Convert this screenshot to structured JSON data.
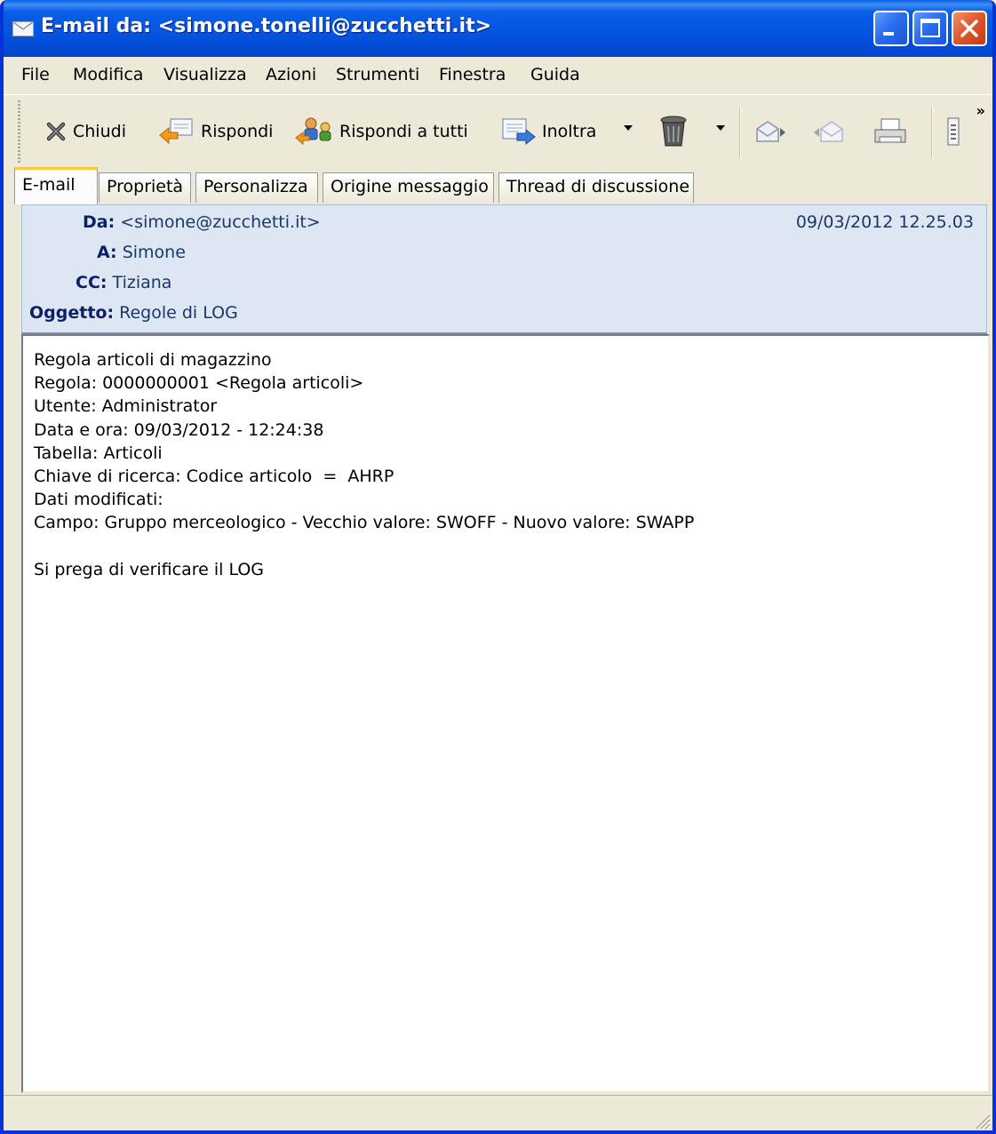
{
  "window": {
    "title": "E-mail da: <simone.tonelli@zucchetti.it>",
    "title_icon": "envelope-icon",
    "controls": [
      "minimize-icon",
      "maximize-icon",
      "close-icon"
    ]
  },
  "menu": [
    "File",
    "Modifica",
    "Visualizza",
    "Azioni",
    "Strumenti",
    "Finestra",
    "Guida"
  ],
  "toolbar": {
    "close_label": "Chiudi",
    "reply_label": "Rispondi",
    "reply_all_label": "Rispondi a tutti",
    "forward_label": "Inoltra",
    "more": "»"
  },
  "tabs": [
    "E-mail",
    "Proprietà",
    "Personalizza",
    "Origine messaggio",
    "Thread di discussione"
  ],
  "header": {
    "from_label": "Da:",
    "from_value": "<simone@zucchetti.it>",
    "to_label": "A:",
    "to_value": "Simone",
    "cc_label": "CC:",
    "cc_value": "Tiziana",
    "subject_label": "Oggetto:",
    "subject_value": "Regole di LOG",
    "date": "09/03/2012 12.25.03"
  },
  "body": {
    "lines": [
      "Regola articoli di magazzino",
      "Regola: 0000000001 <Regola articoli>",
      "Utente: Administrator",
      "Data e ora: 09/03/2012 - 12:24:38",
      "Tabella: Articoli",
      "Chiave di ricerca: Codice articolo  =  AHRP",
      "Dati modificati:",
      "Campo: Gruppo merceologico - Vecchio valore: SWOFF - Nuovo valore: SWAPP",
      "",
      "Si prega di verificare il LOG"
    ]
  },
  "colors": {
    "titlebar": "#0454e0",
    "header_bg": "#dde7f3",
    "header_text": "#1c3667",
    "active_tab_accent": "#ffc83c"
  }
}
